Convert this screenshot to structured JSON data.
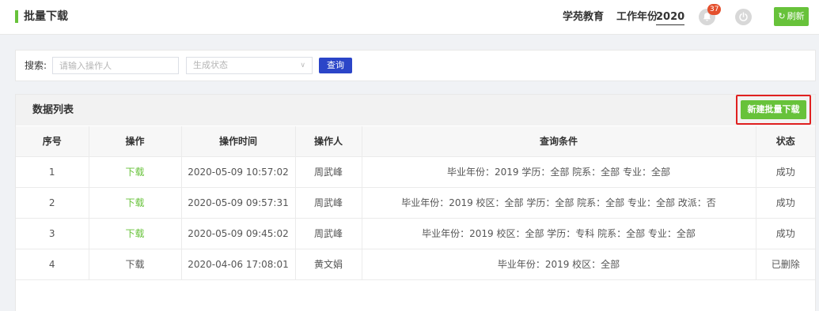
{
  "header": {
    "title": "批量下载",
    "org": "学苑教育",
    "year_label": "工作年份",
    "year_value": "2020",
    "notification_count": "37",
    "refresh_label": "刷新",
    "refresh_icon": "refresh-icon"
  },
  "search": {
    "label": "搜索:",
    "operator_placeholder": "请输入操作人",
    "operator_value": "",
    "status_placeholder": "生成状态",
    "query_label": "查询"
  },
  "list": {
    "title": "数据列表",
    "new_button": "新建批量下载",
    "columns": [
      "序号",
      "操作",
      "操作时间",
      "操作人",
      "查询条件",
      "状态"
    ],
    "rows": [
      {
        "index": "1",
        "action": "下载",
        "action_enabled": true,
        "time": "2020-05-09 10:57:02",
        "operator": "周武峰",
        "conditions": "毕业年份：2019 学历：全部 院系：全部 专业：全部",
        "status": "成功"
      },
      {
        "index": "2",
        "action": "下载",
        "action_enabled": true,
        "time": "2020-05-09 09:57:31",
        "operator": "周武峰",
        "conditions": "毕业年份：2019 校区：全部 学历：全部 院系：全部 专业：全部 改派：否",
        "status": "成功"
      },
      {
        "index": "3",
        "action": "下载",
        "action_enabled": true,
        "time": "2020-05-09 09:45:02",
        "operator": "周武峰",
        "conditions": "毕业年份：2019 校区：全部 学历：专科 院系：全部 专业：全部",
        "status": "成功"
      },
      {
        "index": "4",
        "action": "下载",
        "action_enabled": false,
        "time": "2020-04-06 17:08:01",
        "operator": "黄文娟",
        "conditions": "毕业年份：2019 校区：全部",
        "status": "已删除"
      }
    ]
  },
  "colors": {
    "accent_green": "#67c23a",
    "query_blue": "#2b45c8",
    "badge_red": "#e4502d",
    "highlight_red": "#e02020"
  }
}
